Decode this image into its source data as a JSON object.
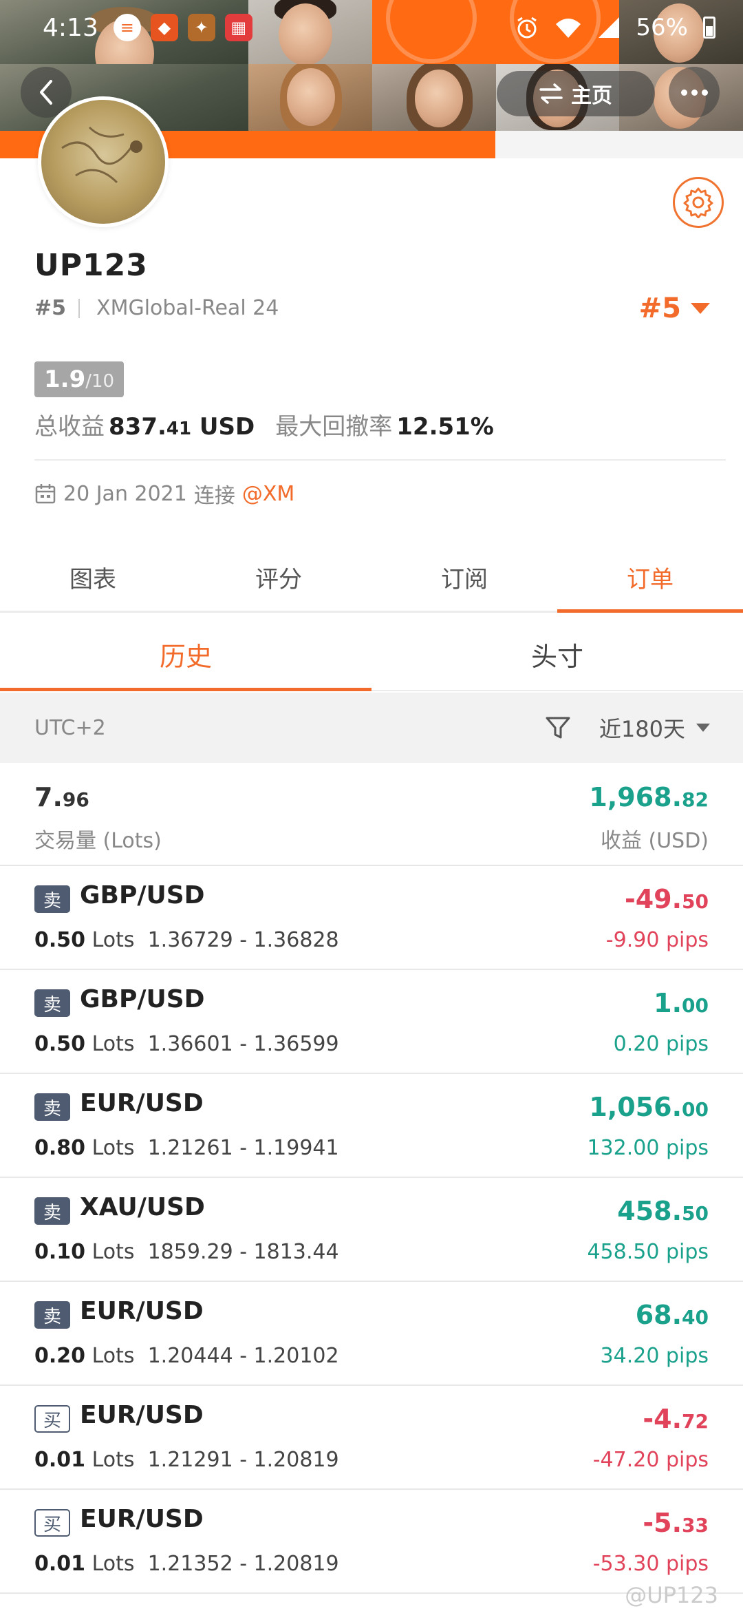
{
  "statusbar": {
    "time": "4:13",
    "battery": "56%"
  },
  "header": {
    "home_label": "主页"
  },
  "profile": {
    "name": "UP123",
    "rank": "#5",
    "server": "XMGlobal-Real 24",
    "rank_badge": "#5",
    "score": "1.9",
    "score_den": "/10",
    "total_profit_label": "总收益",
    "total_profit_int": "837.",
    "total_profit_dec": "41",
    "total_profit_unit": "USD",
    "drawdown_label": "最大回撤率",
    "drawdown_value": "12.51%",
    "connected_date": "20 Jan 2021",
    "connected_label": "连接",
    "broker": "@XM"
  },
  "tabs": [
    "图表",
    "评分",
    "订阅",
    "订单"
  ],
  "subtabs": [
    "历史",
    "头寸"
  ],
  "filter": {
    "timezone": "UTC+2",
    "period": "近180天"
  },
  "summary": {
    "lots_int": "7.",
    "lots_dec": "96",
    "lots_label": "交易量 (Lots)",
    "profit_int": "1,968.",
    "profit_dec": "82",
    "profit_label": "收益 (USD)"
  },
  "trades": [
    {
      "side": "卖",
      "pair": "GBP/USD",
      "lots": "0.50",
      "lots_unit": "Lots",
      "prices": "1.36729 - 1.36828",
      "pl_int": "-49.",
      "pl_dec": "50",
      "pips": "-9.90 pips",
      "tone": "neg"
    },
    {
      "side": "卖",
      "pair": "GBP/USD",
      "lots": "0.50",
      "lots_unit": "Lots",
      "prices": "1.36601 - 1.36599",
      "pl_int": "1.",
      "pl_dec": "00",
      "pips": "0.20 pips",
      "tone": "pos"
    },
    {
      "side": "卖",
      "pair": "EUR/USD",
      "lots": "0.80",
      "lots_unit": "Lots",
      "prices": "1.21261 - 1.19941",
      "pl_int": "1,056.",
      "pl_dec": "00",
      "pips": "132.00 pips",
      "tone": "pos"
    },
    {
      "side": "卖",
      "pair": "XAU/USD",
      "lots": "0.10",
      "lots_unit": "Lots",
      "prices": "1859.29 - 1813.44",
      "pl_int": "458.",
      "pl_dec": "50",
      "pips": "458.50 pips",
      "tone": "pos"
    },
    {
      "side": "卖",
      "pair": "EUR/USD",
      "lots": "0.20",
      "lots_unit": "Lots",
      "prices": "1.20444 - 1.20102",
      "pl_int": "68.",
      "pl_dec": "40",
      "pips": "34.20 pips",
      "tone": "pos"
    },
    {
      "side": "买",
      "pair": "EUR/USD",
      "lots": "0.01",
      "lots_unit": "Lots",
      "prices": "1.21291 - 1.20819",
      "pl_int": "-4.",
      "pl_dec": "72",
      "pips": "-47.20 pips",
      "tone": "neg"
    },
    {
      "side": "买",
      "pair": "EUR/USD",
      "lots": "0.01",
      "lots_unit": "Lots",
      "prices": "1.21352 - 1.20819",
      "pl_int": "-5.",
      "pl_dec": "33",
      "pips": "-53.30 pips",
      "tone": "neg"
    }
  ],
  "watermark": "@UP123"
}
